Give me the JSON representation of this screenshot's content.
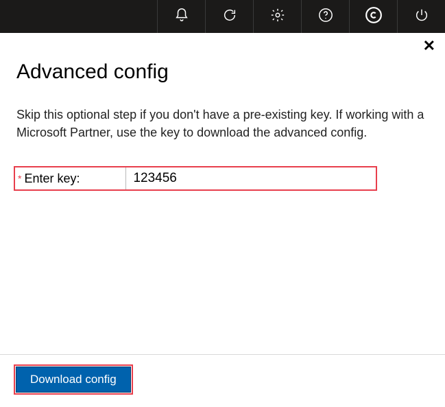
{
  "topbar": {
    "icons": [
      "notifications-icon",
      "refresh-icon",
      "settings-icon",
      "help-icon",
      "copyright-icon",
      "power-icon"
    ]
  },
  "panel": {
    "close_label": "✕",
    "title": "Advanced config",
    "description": "Skip this optional step if you don't have a pre-existing key. If working with a Microsoft Partner, use the key to download the advanced config.",
    "field": {
      "required_indicator": "*",
      "label": "Enter key:",
      "value": "123456"
    },
    "download_button": "Download config"
  }
}
